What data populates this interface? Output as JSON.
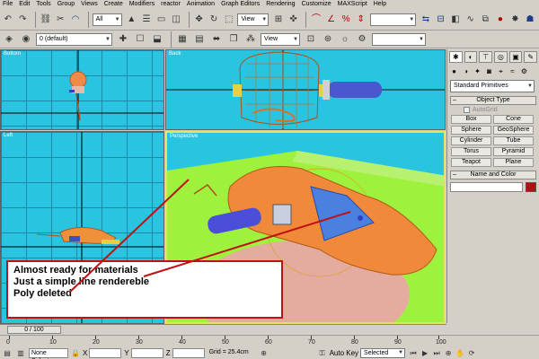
{
  "menu": [
    "File",
    "Edit",
    "Tools",
    "Group",
    "Views",
    "Create",
    "Modifiers",
    "reactor",
    "Animation",
    "Graph Editors",
    "Rendering",
    "Customize",
    "MAXScript",
    "Help"
  ],
  "toolbar": {
    "selection_filter": "All",
    "ref_coord": "View",
    "named_selection": "",
    "layer": "0 (default)",
    "view2": "View"
  },
  "viewports": {
    "top_left": "Bottom",
    "top_right": "Back",
    "bottom_left": "Left",
    "bottom_right": "Perspective"
  },
  "command_panel": {
    "dropdown": "Standard Primitives",
    "object_type_title": "Object Type",
    "autogrid": "AutoGrid",
    "buttons": [
      "Box",
      "Cone",
      "Sphere",
      "GeoSphere",
      "Cylinder",
      "Tube",
      "Torus",
      "Pyramid",
      "Teapot",
      "Plane"
    ],
    "name_color_title": "Name and Color",
    "object_color": "#b01010"
  },
  "timeline": {
    "slider": "0 / 100",
    "ticks": [
      "0",
      "10",
      "20",
      "30",
      "40",
      "50",
      "60",
      "70",
      "80",
      "90",
      "100"
    ]
  },
  "status": {
    "selection": "None Selecte",
    "x_label": "X",
    "y_label": "Y",
    "z_label": "Z",
    "grid": "Grid = 25.4cm",
    "autokey": "Auto Key",
    "selected": "Selected"
  },
  "annotation": {
    "lines": [
      "Almost ready for materials",
      "Just a simple line rendereble",
      "Poly deleted"
    ],
    "color": "#c01010"
  }
}
